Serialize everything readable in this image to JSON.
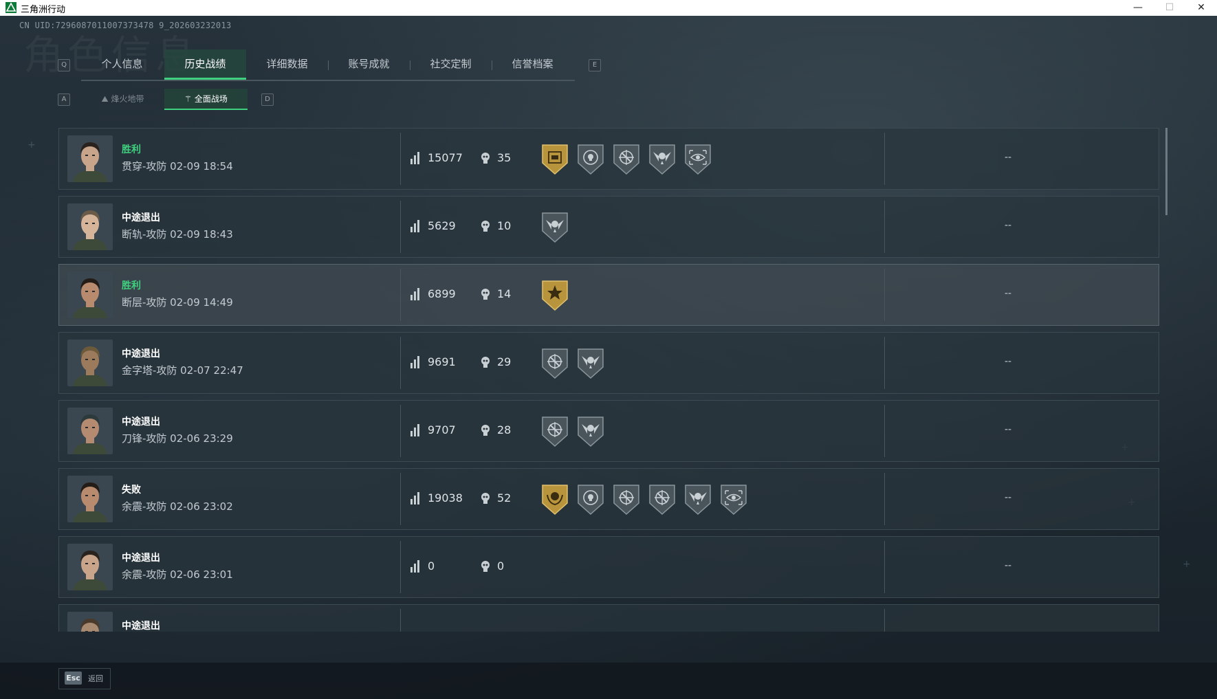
{
  "window": {
    "title": "三角洲行动",
    "min": "—",
    "max": "☐",
    "close": "✕"
  },
  "uid": "CN UID:7296087011007373478 9_202603232013",
  "bg_title": "角色信息",
  "keys": {
    "tab_left": "Q",
    "tab_right": "E",
    "sub_left": "A",
    "sub_right": "D"
  },
  "tabs": [
    {
      "label": "个人信息"
    },
    {
      "label": "历史战绩",
      "active": true
    },
    {
      "label": "详细数据"
    },
    {
      "label": "账号成就"
    },
    {
      "label": "社交定制"
    },
    {
      "label": "信誉档案"
    }
  ],
  "subtabs": [
    {
      "label": "烽火地带",
      "icon": "fire-zone-icon",
      "active": false
    },
    {
      "label": "全面战场",
      "icon": "battlefield-icon",
      "active": true
    }
  ],
  "colors": {
    "accent": "#3fd17f",
    "win": "#3fd17f",
    "gold_medal": "#b8953c",
    "gray_medal": "#4a545b"
  },
  "matches": [
    {
      "result": "胜利",
      "win": true,
      "map": "贯穿-攻防 02-09 18:54",
      "score": "15077",
      "kills": "35",
      "medals": [
        "gold-box",
        "skull-target",
        "crosshair",
        "winged-skull",
        "eye-scope"
      ],
      "extra": "--",
      "avatar": "female-operator"
    },
    {
      "result": "中途退出",
      "win": false,
      "map": "断轨-攻防 02-09 18:43",
      "score": "5629",
      "kills": "10",
      "medals": [
        "winged-skull"
      ],
      "extra": "--",
      "avatar": "glasses-operator"
    },
    {
      "result": "胜利",
      "win": true,
      "map": "断层-攻防 02-09 14:49",
      "score": "6899",
      "kills": "14",
      "medals": [
        "gold-star"
      ],
      "extra": "--",
      "avatar": "bearded-operator",
      "highlight": true
    },
    {
      "result": "中途退出",
      "win": false,
      "map": "金字塔-攻防 02-07 22:47",
      "score": "9691",
      "kills": "29",
      "medals": [
        "crosshair",
        "winged-skull"
      ],
      "extra": "--",
      "avatar": "crowned-operator"
    },
    {
      "result": "中途退出",
      "win": false,
      "map": "刀锋-攻防 02-06 23:29",
      "score": "9707",
      "kills": "28",
      "medals": [
        "crosshair",
        "winged-skull"
      ],
      "extra": "--",
      "avatar": "cap-operator"
    },
    {
      "result": "失败",
      "win": false,
      "map": "余震-攻防 02-06 23:02",
      "score": "19038",
      "kills": "52",
      "medals": [
        "gold-laurel",
        "skull-target",
        "crosshair",
        "crosshair",
        "winged-skull",
        "eye-scope"
      ],
      "extra": "--",
      "avatar": "bearded-operator"
    },
    {
      "result": "中途退出",
      "win": false,
      "map": "余震-攻防 02-06 23:01",
      "score": "0",
      "kills": "0",
      "medals": [],
      "extra": "--",
      "avatar": "female-operator"
    },
    {
      "result": "中途退出",
      "win": false,
      "map": "",
      "score": "",
      "kills": "",
      "medals": [],
      "extra": "",
      "avatar": "generic-operator",
      "partial": true
    }
  ],
  "footer": {
    "esc": "Esc",
    "back": "返回"
  }
}
